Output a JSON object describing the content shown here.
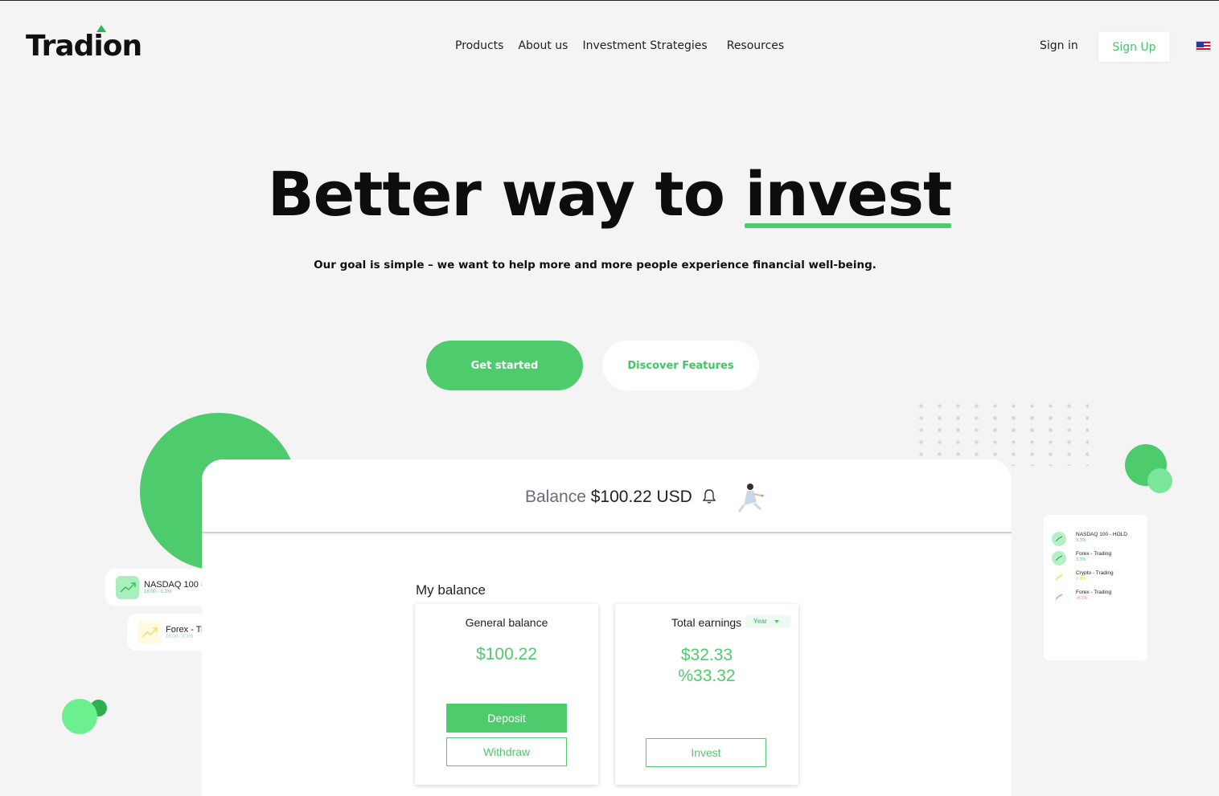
{
  "brand": {
    "name": "Tradion"
  },
  "nav": {
    "items": [
      "Products",
      "About us",
      "Investment Strategies",
      "Resources"
    ],
    "sign_in": "Sign in",
    "sign_up": "Sign Up"
  },
  "hero": {
    "title_prefix": "Better way to ",
    "title_highlight": "invest",
    "subtitle": "Our goal is simple – we want to help more and more people experience financial well-being.",
    "cta_primary": "Get started",
    "cta_secondary": "Discover Features"
  },
  "floating_cards": [
    {
      "title": "NASDAQ 100 -",
      "sub": "16:00 - 3.3%"
    },
    {
      "title": "Forex - Tr",
      "sub": "16:00 - 3.3%"
    }
  ],
  "watchlist": [
    {
      "name": "NASDAQ 100 - HOLD",
      "pct": "3.3%",
      "color": "#4ecb6d"
    },
    {
      "name": "Forex - Trading",
      "pct": "3.3%",
      "color": "#4ecb6d"
    },
    {
      "name": "Crypto - Trading",
      "pct": "2.4%",
      "color": "#e8d43a"
    },
    {
      "name": "Forex - Trading",
      "pct": "-0.1%",
      "color": "#f07b7b"
    }
  ],
  "dashboard": {
    "balance_label": "Balance",
    "balance_value": "$100.22 USD",
    "section_title": "My balance",
    "general": {
      "title": "General balance",
      "amount": "$100.22",
      "deposit": "Deposit",
      "withdraw": "Withdraw"
    },
    "earnings": {
      "title": "Total earnings",
      "period": "Year",
      "amount": "$32.33",
      "percent": "%33.32",
      "invest": "Invest"
    }
  },
  "colors": {
    "accent": "#4ecb6d",
    "background": "#f4f4f4"
  }
}
